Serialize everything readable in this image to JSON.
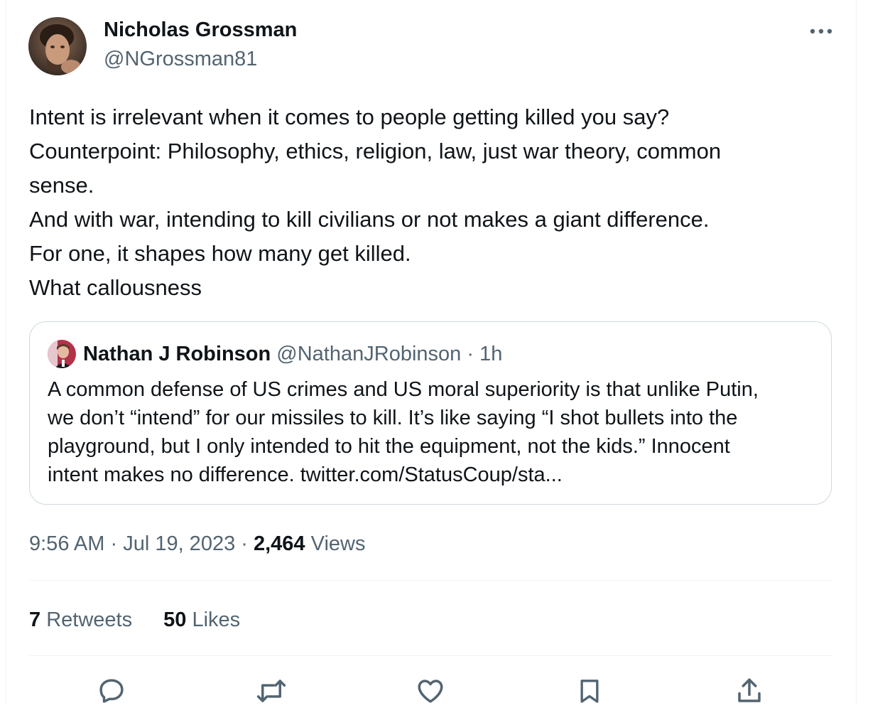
{
  "author": {
    "name": "Nicholas Grossman",
    "handle": "@NGrossman81"
  },
  "tweet": {
    "lines": [
      "Intent is irrelevant when it comes to people getting killed you say?",
      "Counterpoint: Philosophy, ethics, religion, law, just war theory, common",
      "sense.",
      "And with war, intending to kill civilians or not makes a giant difference.",
      "For one, it shapes how many get killed.",
      "What callousness"
    ]
  },
  "quote": {
    "name": "Nathan J Robinson",
    "handle": "@NathanJRobinson",
    "separator": " · ",
    "time": "1h",
    "lines": [
      "A common defense of US crimes and US moral superiority is that unlike Putin,",
      "we don’t “intend” for our missiles to kill. It’s like saying “I shot bullets into the",
      "playground, but I only intended to hit the equipment, not the kids.” Innocent",
      "intent makes no difference. twitter.com/StatusCoup/sta..."
    ]
  },
  "meta": {
    "time": "9:56 AM",
    "separator": " · ",
    "date": "Jul 19, 2023",
    "views_count": "2,464",
    "views_label": " Views"
  },
  "stats": {
    "retweets_count": "7",
    "retweets_label": " Retweets",
    "likes_count": "50",
    "likes_label": " Likes"
  },
  "icons": {
    "more": "more-horizontal-icon",
    "reply": "reply-icon",
    "retweet": "retweet-icon",
    "like": "heart-icon",
    "bookmark": "bookmark-icon",
    "share": "share-icon"
  },
  "colors": {
    "text_primary": "#0f1419",
    "text_secondary": "#536471",
    "border": "#cfd9de",
    "divider": "#eff3f4"
  }
}
